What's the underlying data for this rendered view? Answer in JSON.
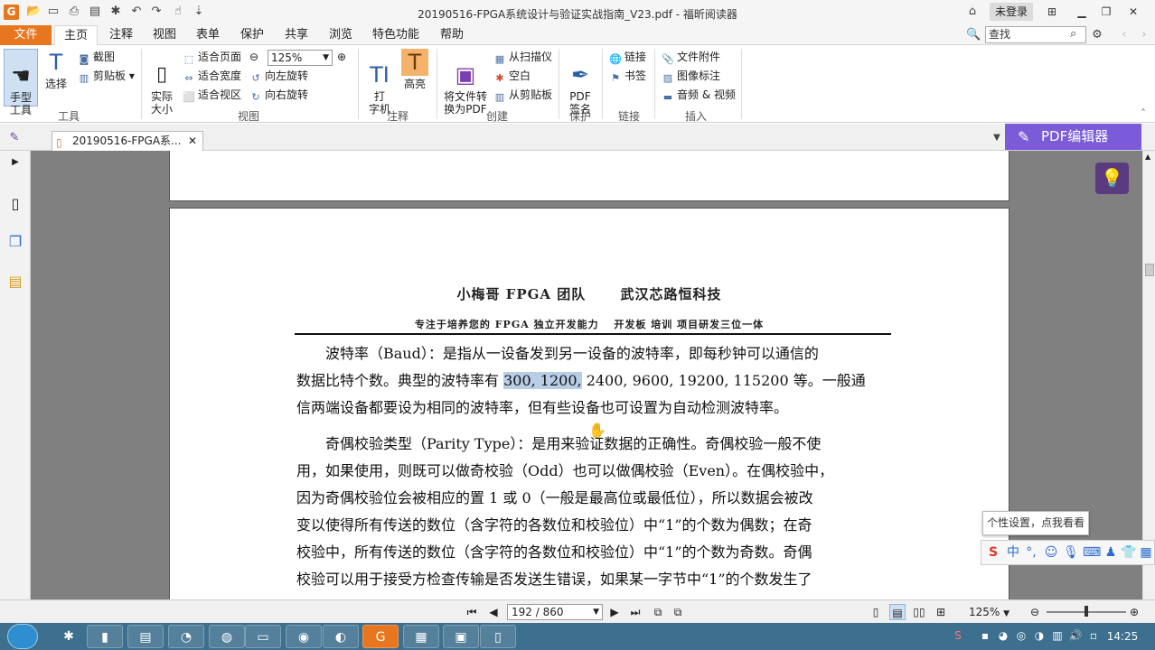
{
  "window": {
    "title": "20190516-FPGA系统设计与验证实战指南_V23.pdf - 福昕阅读器",
    "login": "未登录"
  },
  "menu": {
    "file": "文件",
    "items": [
      "主页",
      "注释",
      "视图",
      "表单",
      "保护",
      "共享",
      "浏览",
      "特色功能",
      "帮助"
    ],
    "search_placeholder": "查找"
  },
  "ribbon": {
    "tools": {
      "hand": "手型\n工具",
      "select": "选择",
      "screenshot": "截图",
      "clipboard": "剪贴板",
      "label": "工具"
    },
    "view": {
      "actual_size": "实际\n大小",
      "fit_page": "适合页面",
      "fit_width": "适合宽度",
      "fit_visible": "适合视区",
      "zoom": "125%",
      "rotate_left": "向左旋转",
      "rotate_right": "向右旋转",
      "label": "视图"
    },
    "comment": {
      "typewriter": "打\n字机",
      "highlight": "高亮",
      "label": "注释"
    },
    "create": {
      "convert": "将文件转\n换为PDF",
      "from_scanner": "从扫描仪",
      "blank": "空白",
      "from_clipboard": "从剪贴板",
      "label": "创建"
    },
    "protect": {
      "sign": "PDF\n签名",
      "label": "保护"
    },
    "links": {
      "link": "链接",
      "bookmark": "书签",
      "label": "链接"
    },
    "insert": {
      "attachment": "文件附件",
      "image": "图像标注",
      "media": "音频 & 视频",
      "label": "插入"
    }
  },
  "tabs": {
    "doc_tab": "20190516-FPGA系...",
    "pdf_editor": "PDF编辑器"
  },
  "document": {
    "header_line1": "小梅哥 FPGA 团队　　 武汉芯路恒科技",
    "header_line2": "专注于培养您的 FPGA 独立开发能力　 开发板 培训 项目研发三位一体",
    "para1": [
      "　　波特率（Baud）：是指从一设备发到另一设备的波特率，即每秒钟可以通信的",
      "数据比特个数。典型的波特率有 ",
      "300, 1200,",
      " 2400, 9600, 19200, 115200 等。一般通",
      "信两端设备都要设为相同的波特率，但有些设备也可设置为自动检测波特率。"
    ],
    "para2": [
      "　　奇偶校验类型（Parity Type）：是用来验证数据的正确性。奇偶校验一般不使",
      "用，如果使用，则既可以做奇校验（Odd）也可以做偶校验（Even）。在偶校验中，",
      "因为奇偶校验位会被相应的置 1 或 0（一般是最高位或最低位），所以数据会被改",
      "变以使得所有传送的数位（含字符的各数位和校验位）中“1”的个数为偶数；在奇",
      "校验中，所有传送的数位（含字符的各数位和校验位）中“1”的个数为奇数。奇偶",
      "校验可以用于接受方检查传输是否发送生错误，如果某一字节中“1”的个数发生了"
    ]
  },
  "status": {
    "page": "192 / 860",
    "zoom": "125%"
  },
  "ime": {
    "tip": "个性设置，点我看看",
    "lang": "中"
  },
  "taskbar": {
    "time": "14:25"
  }
}
